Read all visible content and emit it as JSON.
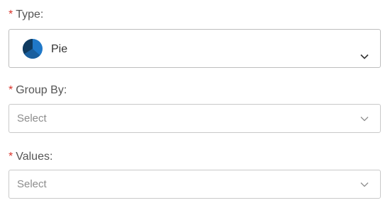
{
  "form": {
    "type": {
      "required_mark": "*",
      "label": "Type:",
      "value": "Pie",
      "icon": "pie-chart-icon"
    },
    "group_by": {
      "required_mark": "*",
      "label": "Group By:",
      "placeholder": "Select",
      "icon": "chevron-down-icon"
    },
    "values": {
      "required_mark": "*",
      "label": "Values:",
      "placeholder": "Select",
      "icon": "chevron-down-icon"
    }
  },
  "colors": {
    "required": "#d9342b",
    "pie_dark": "#0f3a5f",
    "pie_light": "#1f78c8",
    "border": "#c9c9c9",
    "placeholder_text": "#8d8d8d"
  }
}
